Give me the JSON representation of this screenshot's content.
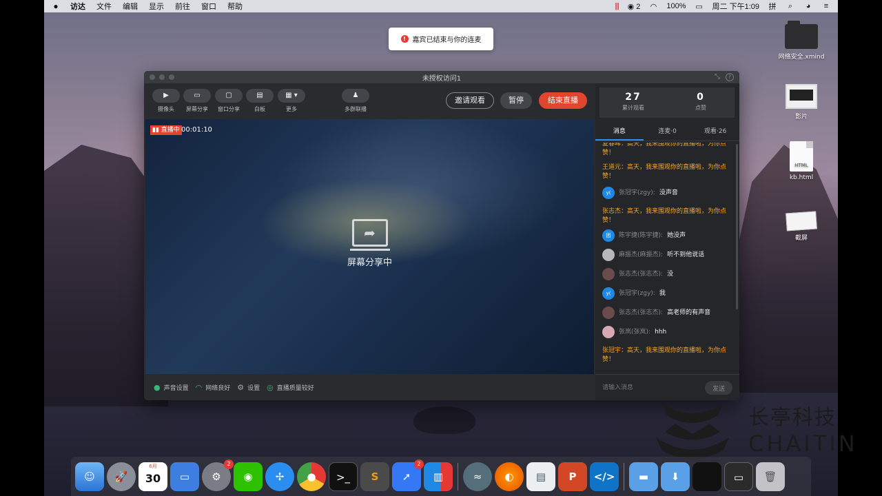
{
  "menubar": {
    "items": [
      "访达",
      "文件",
      "编辑",
      "显示",
      "前往",
      "窗口",
      "帮助"
    ],
    "notif_count": "2",
    "battery": "100%",
    "clock": "周二 下午1:09"
  },
  "toast": {
    "text": "嘉宾已结束与你的连麦"
  },
  "desktop_icons": [
    {
      "label": "网络安全.xmind",
      "icon": "folder-icon"
    },
    {
      "label": "影片",
      "icon": "screen-icon"
    },
    {
      "label": "kb.html",
      "icon": "html-file-icon",
      "badge": "HTML"
    },
    {
      "label": "截屏",
      "icon": "screenshot-icon"
    }
  ],
  "window": {
    "title": "未授权访问1",
    "toolbar": [
      {
        "label": "摄像头",
        "icon": "camera-icon"
      },
      {
        "label": "屏幕分享",
        "icon": "screen-share-icon"
      },
      {
        "label": "窗口分享",
        "icon": "window-share-icon"
      },
      {
        "label": "白板",
        "icon": "whiteboard-icon"
      },
      {
        "label": "更多",
        "icon": "grid-icon"
      },
      {
        "label": "多群联播",
        "icon": "multi-group-icon"
      }
    ],
    "buttons": {
      "invite": "邀请观看",
      "pause": "暂停",
      "end": "结束直播"
    },
    "live": {
      "tag": "直播中",
      "time": "00:01:10"
    },
    "share_text": "屏幕分享中",
    "status": {
      "audio": "声音设置",
      "network": "网络良好",
      "settings": "设置",
      "quality": "直播质量较好"
    }
  },
  "stats": {
    "viewers": {
      "value": "27",
      "label": "累计观看"
    },
    "likes": {
      "value": "0",
      "label": "点赞"
    }
  },
  "tabs": [
    "消息",
    "连麦·0",
    "观看·26"
  ],
  "messages": [
    {
      "type": "system",
      "text": "夏春晖：高天，我来围观你的直播啦，为你点赞！"
    },
    {
      "type": "system",
      "text": "王道元：高天，我来围观你的直播啦，为你点赞！"
    },
    {
      "type": "chat",
      "avatar": "y(",
      "avatar_style": "blue",
      "name": "张冠宇(zgy):",
      "text": "没声音"
    },
    {
      "type": "system",
      "text": "张志杰：高天，我来围观你的直播啦，为你点赞！"
    },
    {
      "type": "chat",
      "avatar": "团",
      "avatar_style": "blue",
      "name": "陈宇捷(陈宇捷):",
      "text": "她没声"
    },
    {
      "type": "chat",
      "avatar": "",
      "avatar_style": "photo1",
      "name": "麻振杰(麻振杰):",
      "text": "听不到他说话"
    },
    {
      "type": "chat",
      "avatar": "",
      "avatar_style": "photo2",
      "name": "张志杰(张志杰):",
      "text": "没"
    },
    {
      "type": "chat",
      "avatar": "y(",
      "avatar_style": "blue",
      "name": "张冠宇(zgy):",
      "text": "我"
    },
    {
      "type": "chat",
      "avatar": "",
      "avatar_style": "photo2",
      "name": "张志杰(张志杰):",
      "text": "高老师的有声音"
    },
    {
      "type": "chat",
      "avatar": "",
      "avatar_style": "photo3",
      "name": "张岚(张岚):",
      "text": "hhh"
    },
    {
      "type": "system",
      "text": "张冠宇：高天，我来围观你的直播啦，为你点赞！"
    }
  ],
  "input": {
    "placeholder": "请输入消息",
    "send": "发送"
  },
  "watermark": {
    "cn": "长亭科技",
    "en": "CHAITIN"
  },
  "dock": {
    "calendar": {
      "month": "6月",
      "day": "30"
    },
    "badges": {
      "system_prefs": "2",
      "feishu": "2"
    }
  }
}
